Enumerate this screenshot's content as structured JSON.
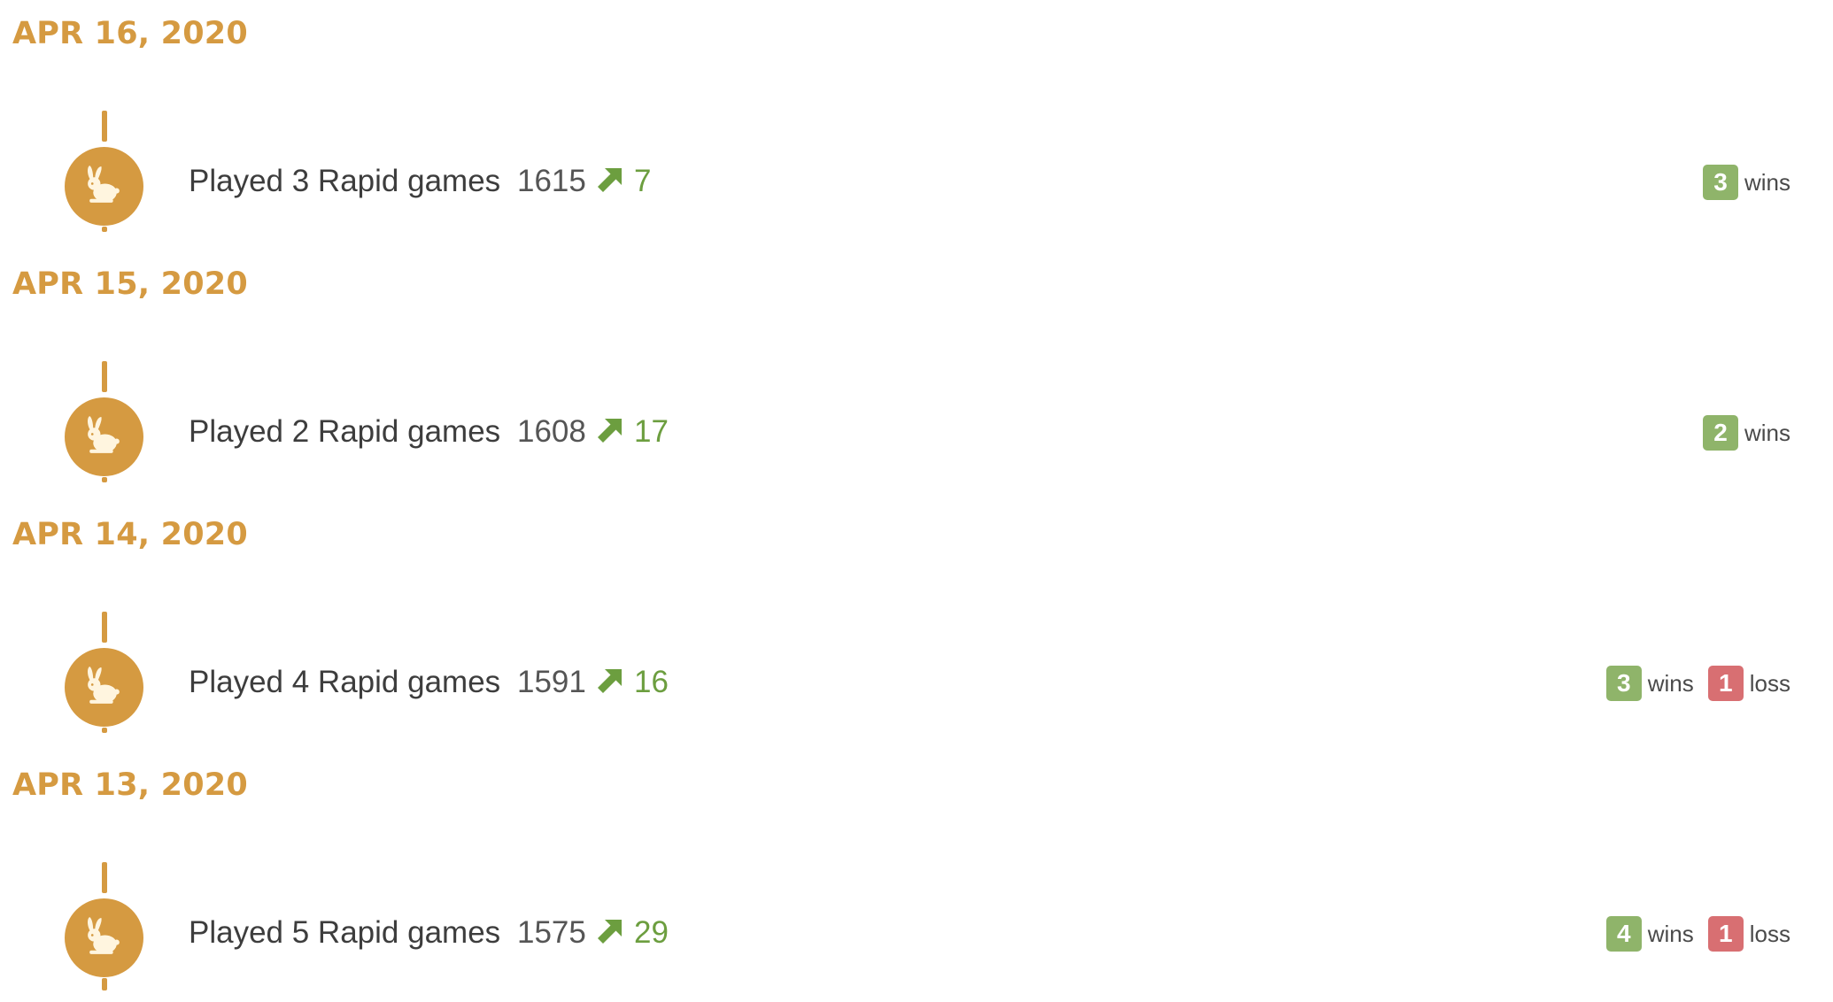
{
  "colors": {
    "accent": "#d59a41",
    "gain": "#6c9e3f",
    "win_badge": "#8fb46a",
    "loss_badge": "#d86f72",
    "icon_glyph": "#fff5df"
  },
  "icon": "rabbit-icon",
  "trend_icon": "arrow-up-right-icon",
  "days": [
    {
      "date": "APR 16, 2020",
      "summary": "Played 3 Rapid games",
      "rating": "1615",
      "delta": "7",
      "results": [
        {
          "type": "win",
          "count": "3",
          "label": "wins"
        }
      ]
    },
    {
      "date": "APR 15, 2020",
      "summary": "Played 2 Rapid games",
      "rating": "1608",
      "delta": "17",
      "results": [
        {
          "type": "win",
          "count": "2",
          "label": "wins"
        }
      ]
    },
    {
      "date": "APR 14, 2020",
      "summary": "Played 4 Rapid games",
      "rating": "1591",
      "delta": "16",
      "results": [
        {
          "type": "win",
          "count": "3",
          "label": "wins"
        },
        {
          "type": "loss",
          "count": "1",
          "label": "loss"
        }
      ]
    },
    {
      "date": "APR 13, 2020",
      "summary": "Played 5 Rapid games",
      "rating": "1575",
      "delta": "29",
      "results": [
        {
          "type": "win",
          "count": "4",
          "label": "wins"
        },
        {
          "type": "loss",
          "count": "1",
          "label": "loss"
        }
      ]
    }
  ]
}
